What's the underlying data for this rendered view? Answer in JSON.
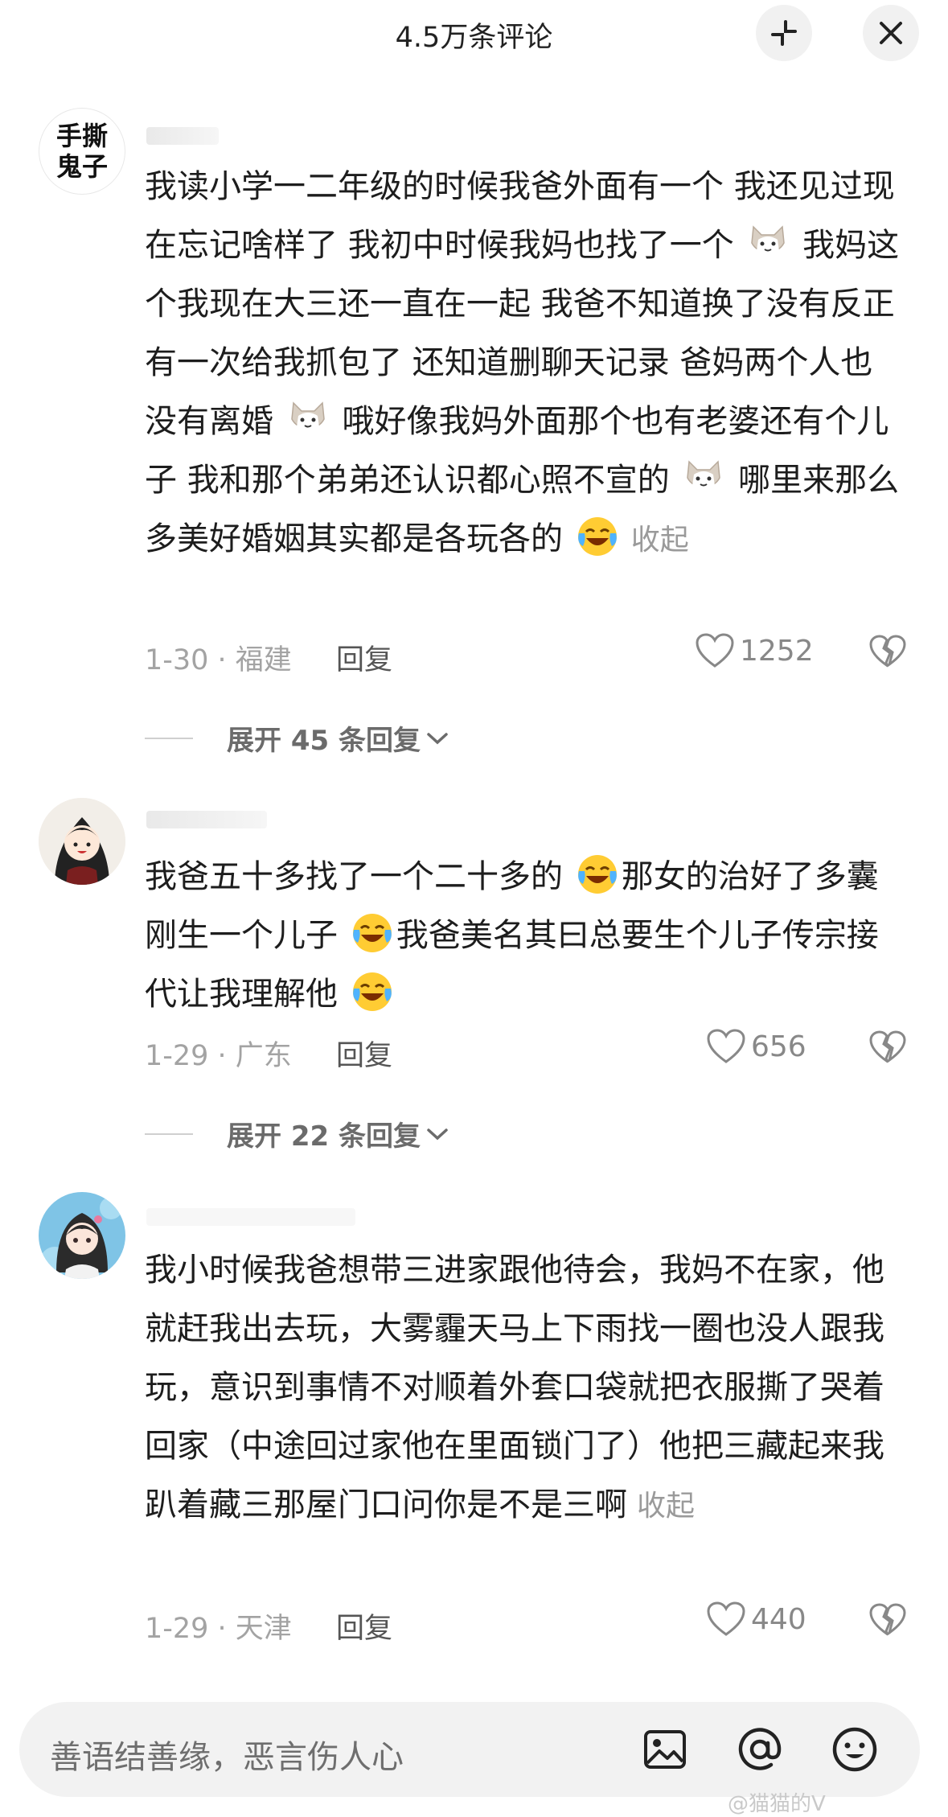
{
  "header": {
    "title": "4.5万条评论",
    "expand_icon": "expand-icon",
    "close_icon": "close-icon"
  },
  "comments": [
    {
      "avatar_text": "手撕鬼子",
      "text_parts": [
        "我读小学一二年级的时候我爸外面有一个 我还见过现在忘记啥样了 我初中时候我妈也找了一个",
        "我妈这个我现在大三还一直在一起 我爸不知道换了没有反正有一次给我抓包了 还知道删聊天记录 爸妈两个人也没有离婚 ",
        "哦好像我妈外面那个也有老婆还有个儿子 我和那个弟弟还认识都心照不宣的",
        "哪里来那么多美好婚姻其实都是各玩各的"
      ],
      "collapse": "收起",
      "meta": "1-30 · 福建",
      "reply": "回复",
      "likes": "1252",
      "expand": "展开 45 条回复"
    },
    {
      "text_parts": [
        "我爸五十多找了一个二十多的",
        "那女的治好了多囊刚生一个儿子",
        "我爸美名其曰总要生个儿子传宗接代让我理解他"
      ],
      "meta": "1-29 · 广东",
      "reply": "回复",
      "likes": "656",
      "expand": "展开 22 条回复"
    },
    {
      "text": "我小时候我爸想带三进家跟他待会，我妈不在家，他就赶我出去玩，大雾霾天马上下雨找一圈也没人跟我玩，意识到事情不对顺着外套口袋就把衣服撕了哭着回家（中途回过家他在里面锁门了）他把三藏起来我趴着藏三那屋门口问你是不是三啊",
      "collapse": "收起",
      "meta": "1-29 · 天津",
      "reply": "回复",
      "likes": "440"
    }
  ],
  "input": {
    "placeholder": "善语结善缘，恶言伤人心"
  },
  "watermark": "@猫猫的V"
}
